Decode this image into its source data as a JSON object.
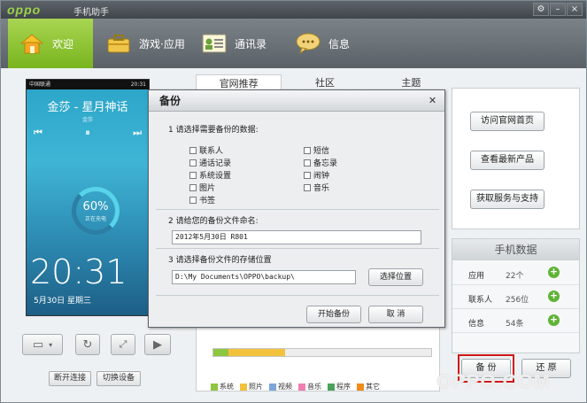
{
  "titlebar": {
    "logo": "oppo",
    "app_name": "手机助手",
    "controls": [
      "⚙",
      "–",
      "×"
    ]
  },
  "nav": {
    "items": [
      {
        "label": "欢迎",
        "icon": "home-icon",
        "active": true
      },
      {
        "label": "游戏·应用",
        "icon": "briefcase-icon",
        "active": false
      },
      {
        "label": "通讯录",
        "icon": "contact-card-icon",
        "active": false
      },
      {
        "label": "信息",
        "icon": "chat-bubble-icon",
        "active": false
      }
    ]
  },
  "phone": {
    "carrier": "中国联通",
    "status_time": "20:31",
    "song": "金莎 - 星月神话",
    "artist": "金莎",
    "battery_percent": "60%",
    "battery_status": "正在充电",
    "clock": "20:31",
    "date": "5月30日 星期三",
    "disconnect_label": "断开连接",
    "switch_label": "切换设备"
  },
  "tabs": [
    "官网推荐",
    "社区",
    "主题"
  ],
  "right_links": [
    "访问官网首页",
    "查看最新产品",
    "获取服务与支持"
  ],
  "phone_data": {
    "title": "手机数据",
    "rows": [
      {
        "label": "应用",
        "value": "22个"
      },
      {
        "label": "联系人",
        "value": "256位"
      },
      {
        "label": "信息",
        "value": "54条"
      }
    ]
  },
  "bottom_buttons": {
    "backup": "备 份",
    "restore": "还 原"
  },
  "storage": {
    "segments": [
      {
        "name": "系统",
        "color": "#8dc63f",
        "fraction": 0.07
      },
      {
        "name": "照片",
        "color": "#f2c23c",
        "fraction": 0.26
      },
      {
        "name": "视频",
        "color": "#7aa7d8",
        "fraction": 0.0
      },
      {
        "name": "音乐",
        "color": "#ee80b0",
        "fraction": 0.0
      },
      {
        "name": "程序",
        "color": "#4aa35a",
        "fraction": 0.0
      },
      {
        "name": "其它",
        "color": "#f08c1a",
        "fraction": 0.0
      }
    ]
  },
  "watermark": "OPPO.COM",
  "dialog": {
    "title": "备份",
    "step1": "1 请选择需要备份的数据:",
    "checkboxes_left": [
      "联系人",
      "通话记录",
      "系统设置",
      "图片",
      "书签"
    ],
    "checkboxes_right": [
      "短信",
      "备忘录",
      "闹钟",
      "音乐"
    ],
    "step2": "2 请给您的备份文件命名:",
    "file_name": "2012年5月30日  R801",
    "step3": "3 请选择备份文件的存储位置",
    "path": "D:\\My Documents\\OPPO\\backup\\",
    "choose_location": "选择位置",
    "start_backup": "开始备份",
    "cancel": "取 消"
  }
}
